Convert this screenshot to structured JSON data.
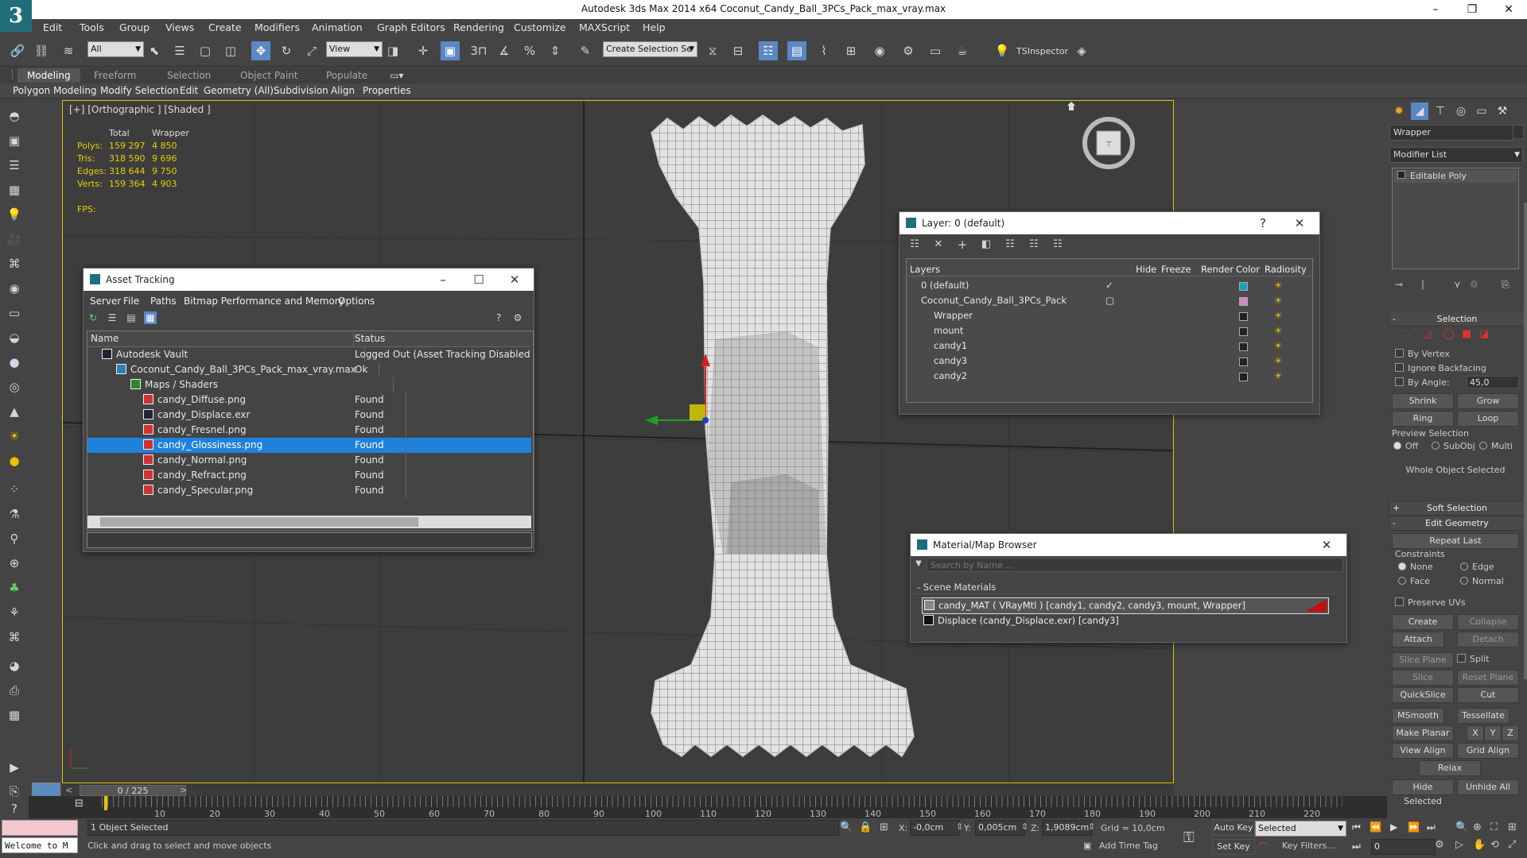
{
  "window": {
    "title": "Autodesk 3ds Max  2014 x64     Coconut_Candy_Ball_3PCs_Pack_max_vray.max",
    "minimize": "–",
    "maximize": "❐",
    "close": "✕"
  },
  "menubar": [
    "Edit",
    "Tools",
    "Group",
    "Views",
    "Create",
    "Modifiers",
    "Animation",
    "Graph Editors",
    "Rendering",
    "Customize",
    "MAXScript",
    "Help"
  ],
  "toolbar": {
    "filter_combo": "All",
    "view_combo": "View",
    "selection_set": "Create Selection Se",
    "tsinspector": "TSInspector",
    "snap_3": "3",
    "snap_percent": "%"
  },
  "ribbon": {
    "tabs": [
      "Modeling",
      "Freeform",
      "Selection",
      "Object Paint",
      "Populate"
    ],
    "subtabs": [
      "Polygon Modeling",
      "Modify Selection",
      "Edit",
      "Geometry (All)",
      "Subdivision",
      "Align",
      "Properties"
    ]
  },
  "viewport": {
    "label": "[+] [Orthographic ] [Shaded ]",
    "stats": {
      "head_total": "Total",
      "head_wrapper": "Wrapper",
      "rows": [
        {
          "label": "Polys:",
          "total": "159 297",
          "wrapper": "4 850"
        },
        {
          "label": "Tris:",
          "total": "318 590",
          "wrapper": "9 696"
        },
        {
          "label": "Edges:",
          "total": "318 644",
          "wrapper": "9 750"
        },
        {
          "label": "Verts:",
          "total": "159 364",
          "wrapper": "4 903"
        }
      ],
      "fps": "FPS:"
    }
  },
  "asset_tracking": {
    "title": "Asset Tracking",
    "menu": [
      "Server",
      "File",
      "Paths",
      "Bitmap Performance and Memory",
      "Options"
    ],
    "col_name": "Name",
    "col_status": "Status",
    "rows": [
      {
        "name": "Autodesk Vault",
        "status": "Logged Out (Asset Tracking Disabled)"
      },
      {
        "name": "Coconut_Candy_Ball_3PCs_Pack_max_vray.max",
        "status": "Ok"
      },
      {
        "name": "Maps / Shaders",
        "status": ""
      },
      {
        "name": "candy_Diffuse.png",
        "status": "Found"
      },
      {
        "name": "candy_Displace.exr",
        "status": "Found"
      },
      {
        "name": "candy_Fresnel.png",
        "status": "Found"
      },
      {
        "name": "candy_Glossiness.png",
        "status": "Found"
      },
      {
        "name": "candy_Normal.png",
        "status": "Found"
      },
      {
        "name": "candy_Refract.png",
        "status": "Found"
      },
      {
        "name": "candy_Specular.png",
        "status": "Found"
      }
    ]
  },
  "layer_window": {
    "title": "Layer: 0 (default)",
    "help": "?",
    "cols": [
      "Layers",
      "Hide",
      "Freeze",
      "Render",
      "Color",
      "Radiosity"
    ],
    "rows": [
      {
        "name": "0 (default)",
        "color": "#1aa0b8"
      },
      {
        "name": "Coconut_Candy_Ball_3PCs_Pack",
        "color": "#d088c8"
      },
      {
        "name": "Wrapper",
        "color": "#222222"
      },
      {
        "name": "mount",
        "color": "#222222"
      },
      {
        "name": "candy1",
        "color": "#222222"
      },
      {
        "name": "candy3",
        "color": "#222222"
      },
      {
        "name": "candy2",
        "color": "#222222"
      }
    ]
  },
  "material_browser": {
    "title": "Material/Map Browser",
    "search_placeholder": "Search by Name ...",
    "group": "- Scene Materials",
    "items": [
      "candy_MAT  ( VRayMtl )  [candy1, candy2, candy3, mount, Wrapper]",
      "Displace (candy_Displace.exr)  [candy3]"
    ]
  },
  "command_panel": {
    "object_name": "Wrapper",
    "modifier_list": "Modifier List",
    "stack_item": "Editable Poly",
    "selection_hdr": "Selection",
    "by_vertex": "By Vertex",
    "ignore_backfacing": "Ignore Backfacing",
    "by_angle": "By Angle:",
    "angle_value": "45,0",
    "shrink": "Shrink",
    "grow": "Grow",
    "ring": "Ring",
    "loop": "Loop",
    "preview_selection": "Preview Selection",
    "preview_off": "Off",
    "preview_subobj": "SubObj",
    "preview_multi": "Multi",
    "whole_object": "Whole Object Selected",
    "soft_selection": "Soft Selection",
    "edit_geometry": "Edit Geometry",
    "repeat_last": "Repeat Last",
    "constraints": "Constraints",
    "c_none": "None",
    "c_edge": "Edge",
    "c_face": "Face",
    "c_normal": "Normal",
    "preserve_uvs": "Preserve UVs",
    "create": "Create",
    "collapse": "Collapse",
    "attach": "Attach",
    "detach": "Detach",
    "slice_plane": "Slice Plane",
    "split": "Split",
    "slice": "Slice",
    "reset_plane": "Reset Plane",
    "quickslice": "QuickSlice",
    "cut": "Cut",
    "msmooth": "MSmooth",
    "tessellate": "Tessellate",
    "make_planar": "Make Planar",
    "x": "X",
    "y": "Y",
    "z": "Z",
    "view_align": "View Align",
    "grid_align": "Grid Align",
    "relax": "Relax",
    "hide_selected": "Hide Selected",
    "unhide_all": "Unhide All"
  },
  "timeline": {
    "frame": "0 / 225",
    "prev": "<",
    "next": ">",
    "ticks": [
      "10",
      "20",
      "30",
      "40",
      "50",
      "60",
      "70",
      "80",
      "90",
      "100",
      "110",
      "120",
      "130",
      "140",
      "150",
      "160",
      "170",
      "180",
      "190",
      "200",
      "210",
      "220"
    ]
  },
  "status": {
    "maxscript": "Welcome to M",
    "selected": "1 Object Selected",
    "prompt": "Click and drag to select and move objects",
    "x_label": "X:",
    "x": "-0,0cm",
    "y_label": "Y:",
    "y": "0,005cm",
    "z_label": "Z:",
    "z": "1,9089cm",
    "grid": "Grid = 10,0cm",
    "add_time_tag": "Add Time Tag",
    "auto_key": "Auto Key",
    "set_key": "Set Key",
    "key_mode": "Selected",
    "key_filters": "Key Filters...",
    "frame_field": "0"
  }
}
